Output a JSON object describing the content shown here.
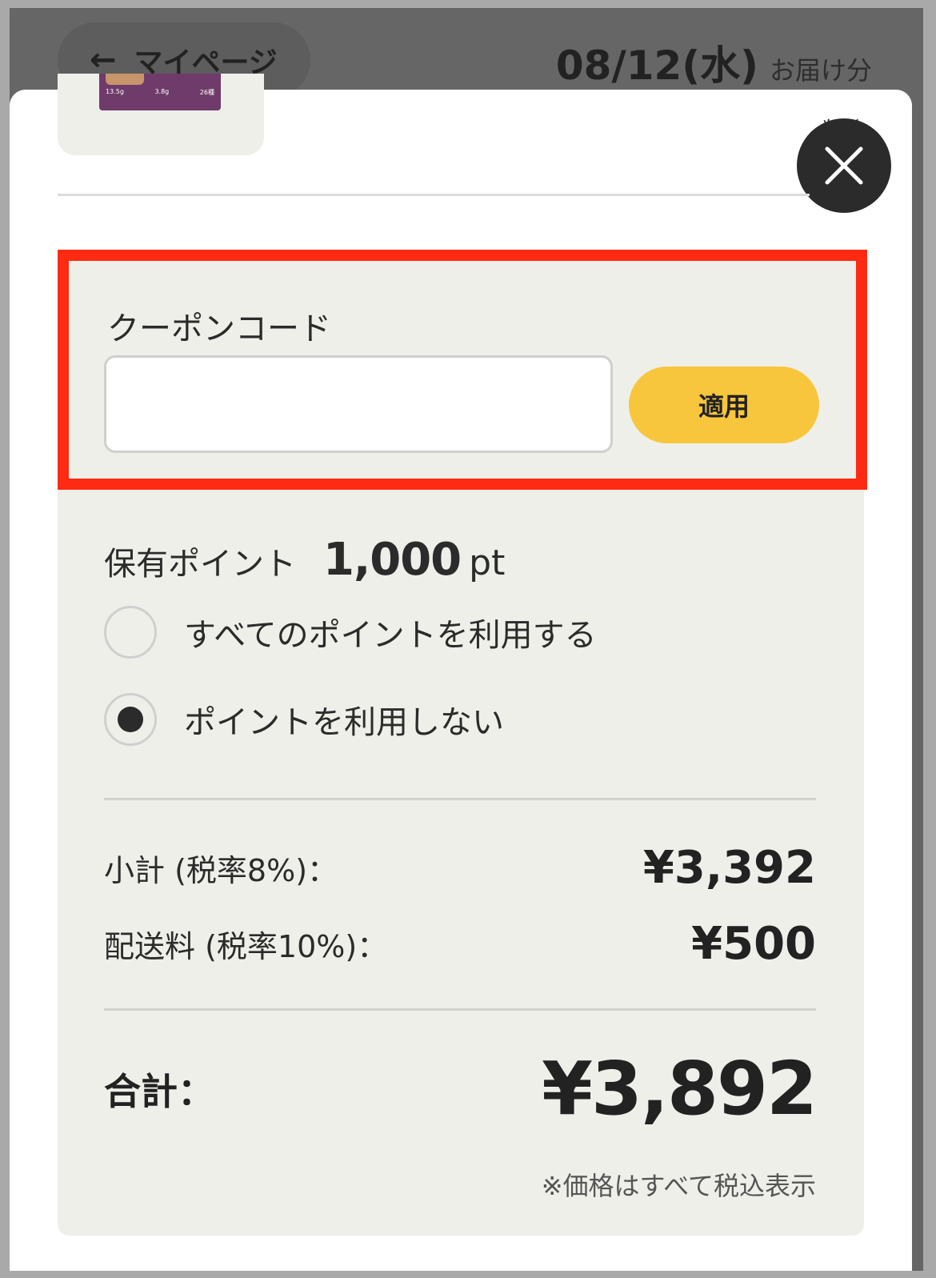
{
  "header": {
    "back_label": "マイページ",
    "delivery_date": "08/12(水)",
    "delivery_suffix": "お届け分"
  },
  "product": {
    "cut_text": "削除"
  },
  "coupon": {
    "label": "クーポンコード",
    "value": "",
    "apply_label": "適用"
  },
  "points": {
    "label": "保有ポイント",
    "value": "1,000",
    "unit": "pt",
    "options": [
      {
        "label": "すべてのポイントを利用する",
        "checked": false
      },
      {
        "label": "ポイントを利用しない",
        "checked": true
      }
    ]
  },
  "summary": {
    "subtotal_label": "小計 (税率8%)：",
    "subtotal_value": "¥3,392",
    "shipping_label": "配送料 (税率10%)：",
    "shipping_value": "¥500",
    "total_label": "合計：",
    "total_value": "¥3,892",
    "tax_note": "※価格はすべて税込表示"
  },
  "colors": {
    "highlight": "#ff2a12",
    "apply_button": "#f8c63d",
    "panel": "#efefea"
  }
}
